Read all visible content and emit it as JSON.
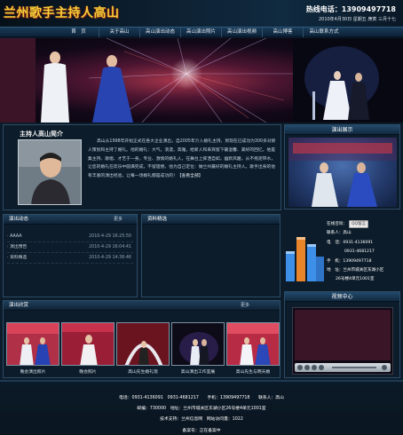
{
  "header": {
    "logo_text": "兰州歌手主持人高山",
    "hotline": "热线电话：13909497718",
    "date": "2010年4月30日 星期五 庚寅 三月十七"
  },
  "nav": [
    "首　页",
    "关于高山",
    "高山演出动态",
    "高山演出照片",
    "高山演出视频",
    "高山博客",
    "高山联系方式"
  ],
  "intro": {
    "title": "主持人高山简介",
    "text": "高山从1998年开始正式在各大企业演出，自2005年介入婚礼主持，到现在已成功为300多对新人策划和主持了婚礼。他的婚礼：大气，浪漫，高雅，给新人和来宾留下最温馨、美好的回忆。他是集主持、歌唱、才艺于一身，专业、激情的婚礼人，在舞台上挥洒自如，幽默风趣，从不拖泥带水，让您的婚礼在欢乐中圆满完成，不留遗憾。他为自己定位：做兰州最好的婚礼主持人。歌手出身的他有丰富的演出经验，让每一场婚礼都是成功的！",
    "more": "【查看全部】"
  },
  "side_show": {
    "title": "演出展示"
  },
  "news": {
    "title": "演出动态",
    "more": "更多",
    "items": [
      {
        "title": "AAAA",
        "date": "2010-4-29 16:25:50"
      },
      {
        "title": "演出预告",
        "date": "2010-4-29 16:04:41"
      },
      {
        "title": "资料精选",
        "date": "2010-4-29 14:36:46"
      }
    ]
  },
  "picks": {
    "title": "资料精选"
  },
  "contact": {
    "qq_label": "在线咨询：",
    "qq_button": "QQ留言",
    "person": "联系人：高山",
    "phone": "电　话：0931-4136091",
    "phone2": "0931-4681217",
    "mobile": "手　机：13909497718",
    "address": "地　址：兰州市城关区东湖小区",
    "address2": "26号楼4单元1001室",
    "colors": {
      "bar_blue": "#3d8fe8",
      "bar_orange": "#e8842a"
    }
  },
  "gallery": {
    "title": "演出欣赏",
    "more": "更多",
    "items": [
      {
        "caption": "晚会演出照片"
      },
      {
        "caption": "晚会照片"
      },
      {
        "caption": "高山先生婚礼现"
      },
      {
        "caption": "高山演出工作室展"
      },
      {
        "caption": "高山先生与明天婚"
      }
    ]
  },
  "video": {
    "title": "视频中心"
  },
  "footer": {
    "line1": "电话：0931-4136091　0931-4681217　　手机：13909497718　　联系人：高山",
    "line2": "邮编：730000　地址：兰州市城关区东湖小区26号楼4单元1001室",
    "line3": "技术支持：兰州信息网　网站访问量：1022",
    "line4": "备案号：正在备案中"
  }
}
